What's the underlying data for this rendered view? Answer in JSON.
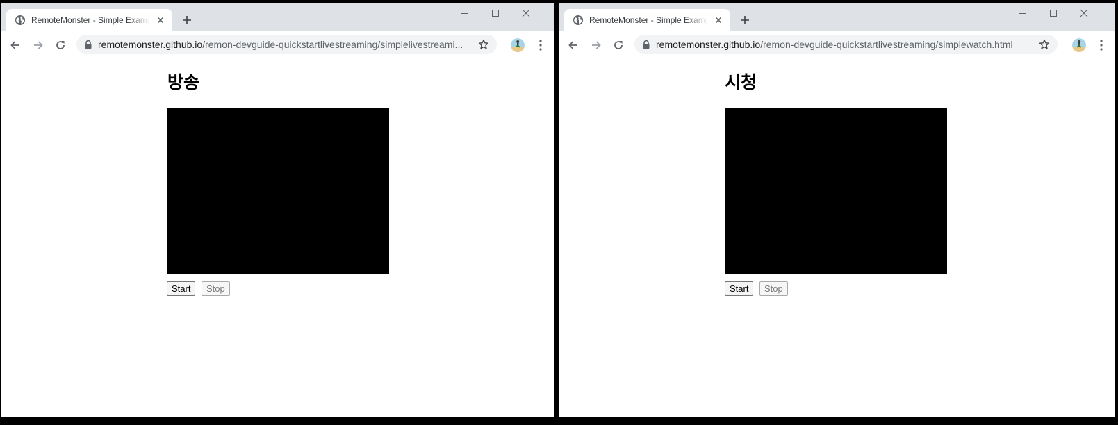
{
  "windows": [
    {
      "tab_title": "RemoteMonster - Simple Example",
      "url_host": "remotemonster.github.io",
      "url_path": "/remon-devguide-quickstartlivestreaming/simplelivestreami...",
      "heading": "방송",
      "start_label": "Start",
      "stop_label": "Stop"
    },
    {
      "tab_title": "RemoteMonster - Simple Example",
      "url_host": "remotemonster.github.io",
      "url_path": "/remon-devguide-quickstartlivestreaming/simplewatch.html",
      "heading": "시청",
      "start_label": "Start",
      "stop_label": "Stop"
    }
  ],
  "icons": {
    "favicon": "globe-icon",
    "tab_close": "close-icon",
    "new_tab": "plus-icon",
    "minimize": "minimize-icon",
    "maximize": "maximize-icon",
    "close": "close-icon",
    "back": "arrow-left-icon",
    "forward": "arrow-right-icon",
    "reload": "reload-icon",
    "lock": "lock-icon",
    "bookmark": "star-icon",
    "avatar": "profile-avatar",
    "menu": "kebab-menu-icon"
  },
  "colors": {
    "titlebar": "#dee1e6",
    "tab_active": "#ffffff",
    "omnibox": "#f1f3f4",
    "video": "#000000",
    "separator": "#000000"
  }
}
